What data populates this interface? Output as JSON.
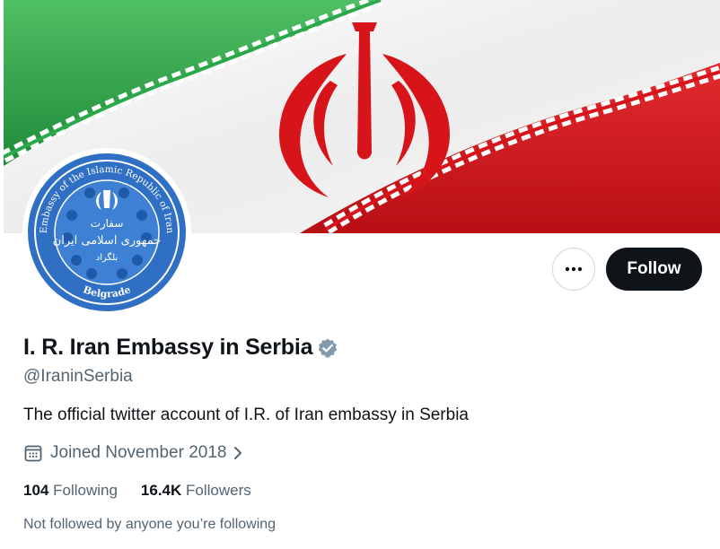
{
  "profile": {
    "display_name": "I. R. Iran Embassy in Serbia",
    "handle": "@IraninSerbia",
    "bio": "The official twitter account of I.R. of Iran embassy in Serbia",
    "joined": "Joined November 2018",
    "following_count": "104",
    "following_label": "Following",
    "followers_count": "16.4K",
    "followers_label": "Followers",
    "not_followed_note": "Not followed by anyone you’re following"
  },
  "avatar": {
    "seal_top_text": "Embassy of the Islamic Republic of Iran",
    "seal_bottom_text": "Belgrade",
    "seal_center_line1": "سفارت",
    "seal_center_line2": "جمهوری اسلامی ایران",
    "seal_center_line3": "بلگراد",
    "seal_color": "#2f6fc4"
  },
  "actions": {
    "follow_label": "Follow",
    "more_icon": "more-horizontal-icon"
  },
  "colors": {
    "flag_green": "#2aa84a",
    "flag_red": "#d7141a",
    "button_dark": "#0f1419",
    "secondary_text": "#536471",
    "verified_gray": "#829aab"
  }
}
